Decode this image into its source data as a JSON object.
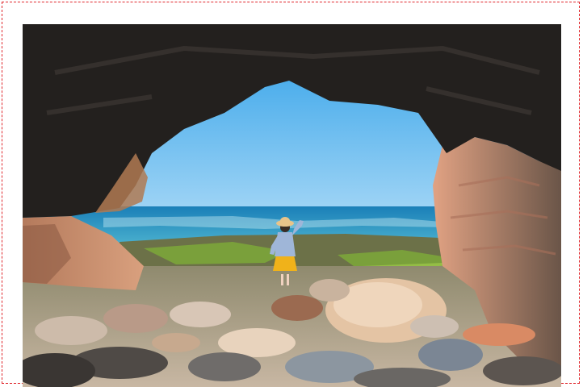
{
  "image": {
    "subject": "sea-cave-beach-scene",
    "colors": {
      "page_background": "#ffffff",
      "frame_border": "#e0262b",
      "sky_top": "#2a9ee8",
      "sky_bottom": "#9fd4f5",
      "sea": "#1e8fc0",
      "cave_rock": "#23201e",
      "sandstone": "#d69a78",
      "moss": "#7ca83a",
      "jacket": "#9fb6d8",
      "skirt": "#f0b21a",
      "hat": "#e8c48a"
    }
  }
}
